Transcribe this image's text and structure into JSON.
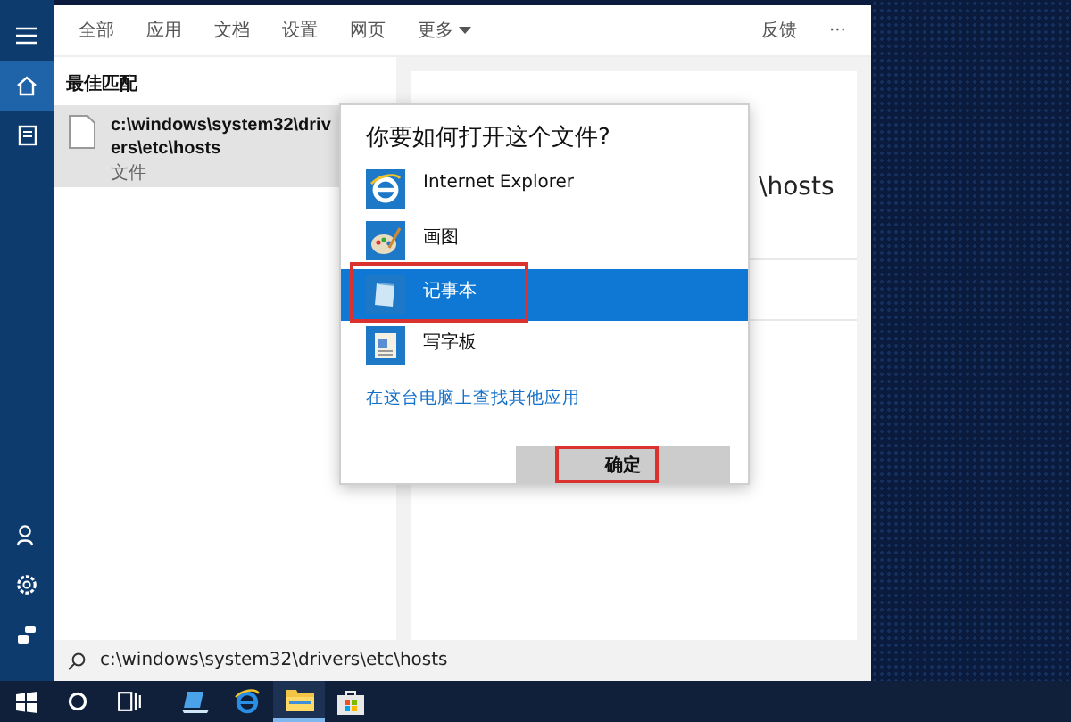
{
  "rail": {
    "top": [
      {
        "kind": "menu",
        "selected": false
      },
      {
        "kind": "home",
        "selected": true
      },
      {
        "kind": "documents",
        "selected": false
      }
    ],
    "bottom": [
      {
        "kind": "account",
        "selected": false
      },
      {
        "kind": "settings",
        "selected": false
      },
      {
        "kind": "feedback",
        "selected": false
      }
    ]
  },
  "tabs": [
    {
      "label": "全部",
      "dropdown": false
    },
    {
      "label": "应用",
      "dropdown": false
    },
    {
      "label": "文档",
      "dropdown": false
    },
    {
      "label": "设置",
      "dropdown": false
    },
    {
      "label": "网页",
      "dropdown": false
    },
    {
      "label": "更多",
      "dropdown": true
    }
  ],
  "header_actions": [
    "反馈",
    "···"
  ],
  "best_match": {
    "heading": "最佳匹配",
    "item": {
      "title": "c:\\windows\\system32\\drivers\\etc\\hosts",
      "subtitle": "文件",
      "selected": true
    }
  },
  "preview": {
    "title": "\\hosts"
  },
  "dialog": {
    "title": "你要如何打开这个文件?",
    "apps": [
      {
        "name": "Internet Explorer",
        "kind": "ie",
        "selected": false,
        "highlighted": false
      },
      {
        "name": "画图",
        "kind": "paint",
        "selected": false,
        "highlighted": false
      },
      {
        "name": "记事本",
        "kind": "notepad",
        "selected": true,
        "highlighted": true
      },
      {
        "name": "写字板",
        "kind": "wordpad",
        "selected": false,
        "highlighted": false
      }
    ],
    "link": "在这台电脑上查找其他应用",
    "button": {
      "label": "确定",
      "highlighted": true
    }
  },
  "search": {
    "value": "c:\\windows\\system32\\drivers\\etc\\hosts"
  },
  "taskbar": [
    {
      "kind": "start",
      "selected": false
    },
    {
      "kind": "cortana",
      "selected": false
    },
    {
      "kind": "taskview",
      "selected": false
    },
    {
      "kind": "computer",
      "selected": false
    },
    {
      "kind": "ie",
      "selected": false
    },
    {
      "kind": "explorer",
      "selected": true
    },
    {
      "kind": "store",
      "selected": false
    }
  ]
}
